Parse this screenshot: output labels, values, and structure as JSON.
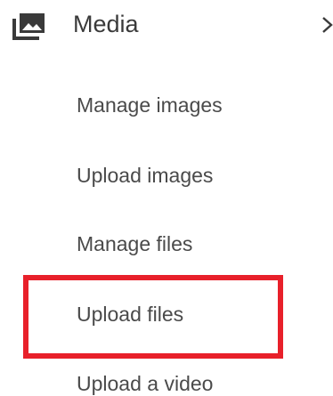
{
  "section": {
    "title": "Media",
    "icon": "media-gallery-icon",
    "expand_icon": "chevron-right-icon"
  },
  "submenu": {
    "items": [
      {
        "label": "Manage images"
      },
      {
        "label": "Upload images"
      },
      {
        "label": "Manage files"
      },
      {
        "label": "Upload files",
        "highlighted": true
      },
      {
        "label": "Upload a video"
      }
    ]
  },
  "colors": {
    "text": "#3a3a3a",
    "icon": "#3a3a3a",
    "highlight": "#e8202a",
    "background": "#ffffff"
  }
}
